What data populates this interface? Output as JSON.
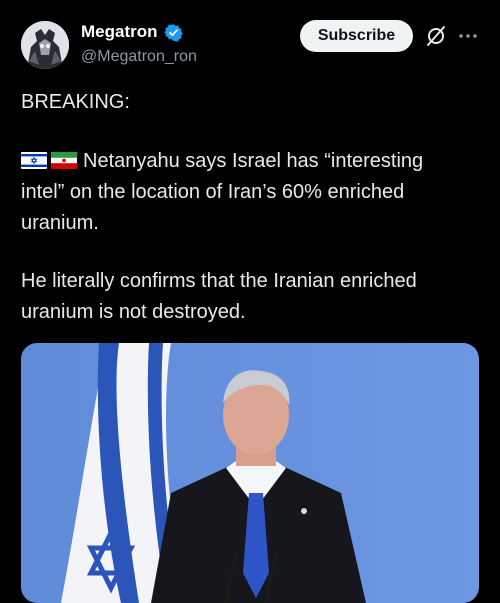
{
  "author": {
    "name": "Megatron",
    "handle": "@Megatron_ron",
    "verified": true
  },
  "actions": {
    "subscribe_label": "Subscribe",
    "grok_icon": "grok-icon",
    "more_icon": "more-icon"
  },
  "post": {
    "heading": "BREAKING:",
    "flags": [
      "israel-flag-icon",
      "iran-flag-icon"
    ],
    "paragraph1": "Netanyahu says Israel has “interesting intel” on the location of Iran’s 60% enriched uranium.",
    "paragraph2": "He literally confirms that the Iranian enriched uranium is not destroyed."
  },
  "colors": {
    "background": "#000000",
    "text": "#e7e9ea",
    "secondary": "#8b98a5",
    "verified": "#1d9bf0",
    "button_bg": "#eff3f4"
  }
}
